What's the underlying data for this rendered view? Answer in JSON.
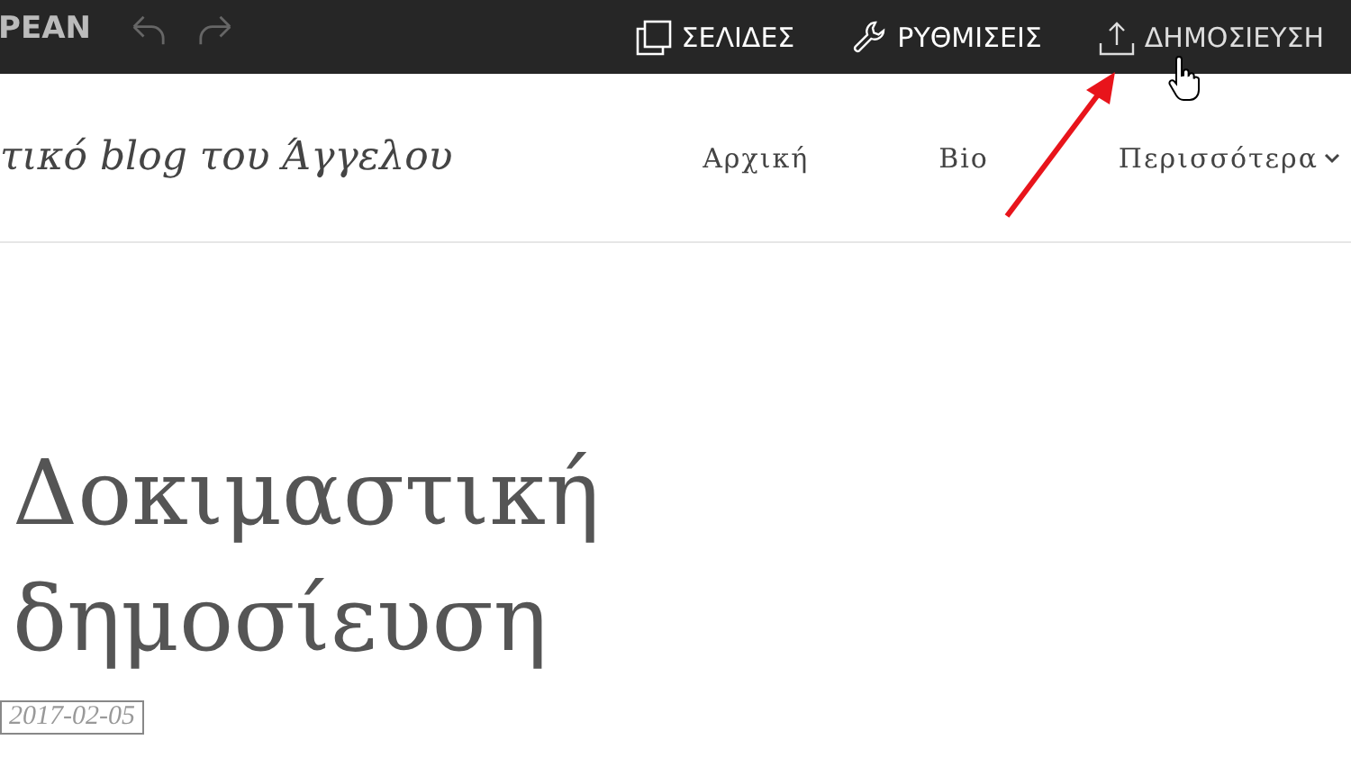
{
  "toolbar": {
    "brand": "PEAN",
    "history": [
      {
        "kind": "undo",
        "disabled": true
      },
      {
        "kind": "redo",
        "disabled": true
      }
    ],
    "actions": [
      {
        "kind": "pages",
        "label": "ΣΕΛΙΔΕΣ"
      },
      {
        "kind": "settings",
        "label": "ΡΥΘΜΙΣΕΙΣ"
      },
      {
        "kind": "publish",
        "label": "ΔΗΜΟΣΙΕΥΣΗ"
      }
    ]
  },
  "site_header": {
    "blog_title": "τικό blog του Άγγελου",
    "nav": [
      {
        "label": "Αρχική",
        "dropdown": false
      },
      {
        "label": "Bio",
        "dropdown": false
      },
      {
        "label": "Περισσότερα",
        "dropdown": true
      }
    ]
  },
  "post": {
    "title": "Δοκιμαστική δημοσίευση",
    "date": "2017-02-05"
  }
}
